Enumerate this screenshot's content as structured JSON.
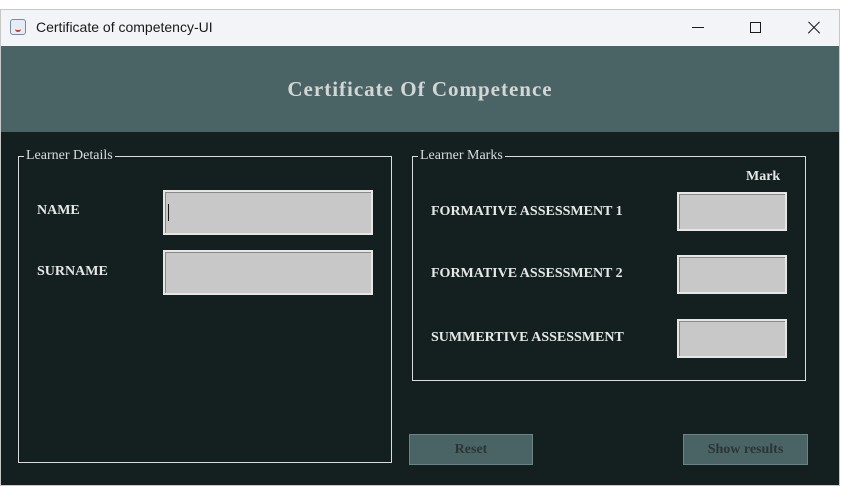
{
  "window": {
    "title": "Certificate of competency-UI"
  },
  "header": {
    "title": "Certificate Of Competence"
  },
  "learner_details": {
    "legend": "Learner Details",
    "name_label": "NAME",
    "name_value": "",
    "surname_label": "SURNAME",
    "surname_value": ""
  },
  "learner_marks": {
    "legend": "Learner Marks",
    "mark_header": "Mark",
    "assessments": [
      {
        "label": "FORMATIVE ASSESSMENT 1",
        "value": ""
      },
      {
        "label": "FORMATIVE ASSESSMENT 2",
        "value": ""
      },
      {
        "label": "SUMMERTIVE ASSESSMENT",
        "value": ""
      }
    ]
  },
  "buttons": {
    "reset": "Reset",
    "show_results": "Show results"
  },
  "colors": {
    "background": "#142020",
    "header": "#4a6466",
    "field": "#c8c8c8",
    "text": "#e6e8e8"
  }
}
